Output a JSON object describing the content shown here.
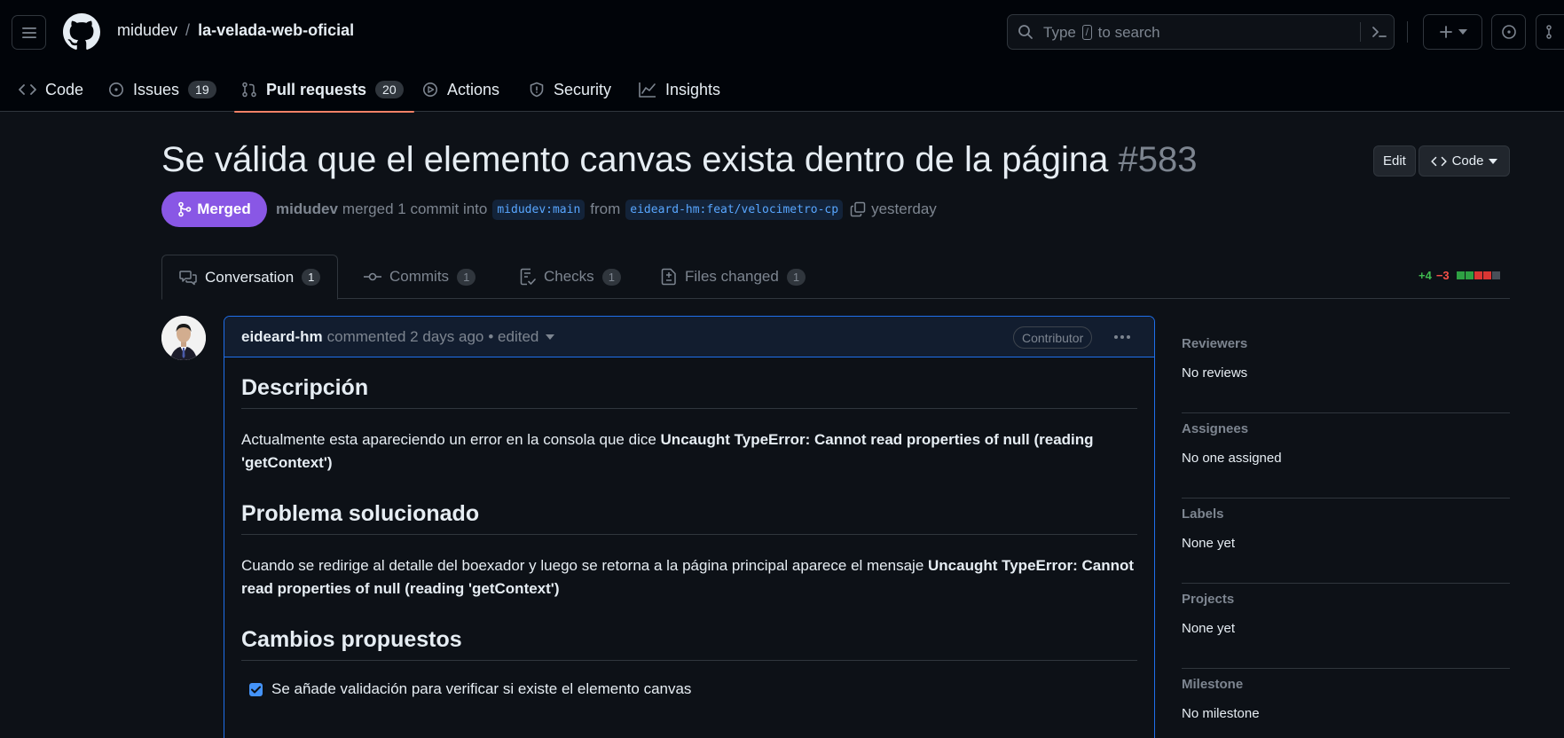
{
  "header": {
    "owner": "midudev",
    "separator": "/",
    "repo": "la-velada-web-oficial",
    "search_before": "Type",
    "search_key": "/",
    "search_after": "to search"
  },
  "nav": [
    {
      "label": "Code",
      "icon": "code-icon"
    },
    {
      "label": "Issues",
      "count": "19",
      "icon": "issue-icon"
    },
    {
      "label": "Pull requests",
      "count": "20",
      "icon": "pull-request-icon",
      "active": true
    },
    {
      "label": "Actions",
      "icon": "play-icon"
    },
    {
      "label": "Security",
      "icon": "shield-icon"
    },
    {
      "label": "Insights",
      "icon": "graph-icon"
    }
  ],
  "pr": {
    "title": "Se válida que el elemento canvas exista dentro de la página",
    "number": "#583",
    "edit_label": "Edit",
    "code_label": "Code",
    "state": "Merged",
    "author": "midudev",
    "action_text": "merged 1 commit into",
    "base_branch": "midudev:main",
    "from_text": "from",
    "head_branch": "eideard-hm:feat/velocimetro-cp",
    "time": "yesterday"
  },
  "tabs": [
    {
      "label": "Conversation",
      "count": "1"
    },
    {
      "label": "Commits",
      "count": "1"
    },
    {
      "label": "Checks",
      "count": "1"
    },
    {
      "label": "Files changed",
      "count": "1"
    }
  ],
  "diffstat": {
    "additions": "+4",
    "deletions": "−3"
  },
  "colors": {
    "merged": "#8957e5",
    "accent": "#1f6feb",
    "add": "#3fb950",
    "del": "#f85149"
  },
  "comment": {
    "author": "eideard-hm",
    "meta": "commented 2 days ago",
    "edited": "• edited",
    "role": "Contributor",
    "h1": "Descripción",
    "p1_text": "Actualmente esta apareciendo un error en la consola que dice ",
    "p1_bold": "Uncaught TypeError: Cannot read properties of null (reading 'getContext')",
    "h2": "Problema solucionado",
    "p2_text": "Cuando se redirige al detalle del boexador y luego se retorna a la página principal aparece el mensaje ",
    "p2_bold": "Uncaught TypeError: Cannot read properties of null (reading 'getContext')",
    "h3": "Cambios propuestos",
    "task": "Se añade validación para verificar si existe el elemento canvas"
  },
  "sidebar": [
    {
      "title": "Reviewers",
      "value": "No reviews"
    },
    {
      "title": "Assignees",
      "value": "No one assigned"
    },
    {
      "title": "Labels",
      "value": "None yet"
    },
    {
      "title": "Projects",
      "value": "None yet"
    },
    {
      "title": "Milestone",
      "value": "No milestone"
    }
  ]
}
